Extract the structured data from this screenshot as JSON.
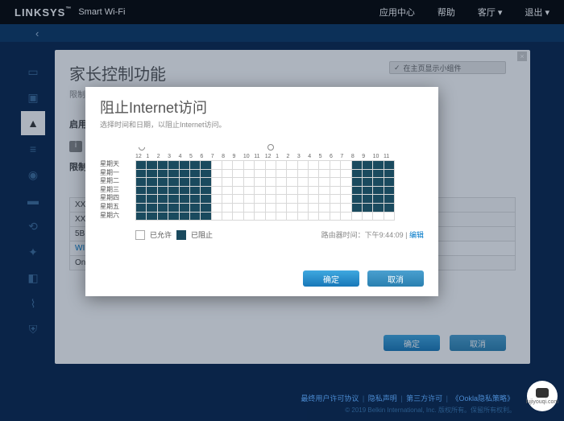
{
  "brand": {
    "name": "LINKSYS",
    "suite": "Smart Wi-Fi"
  },
  "topnav": {
    "appcenter": "应用中心",
    "help": "帮助",
    "account": "客厅",
    "logout": "退出"
  },
  "page": {
    "title": "家长控制功能",
    "subtitle": "限制",
    "enable_label": "启用",
    "restrict_label": "限制I"
  },
  "widget": {
    "label": "在主页显示小组件"
  },
  "devices": {
    "row1": "XX",
    "row2": "XX",
    "row3": "5B",
    "row4": "WI",
    "row5": "On"
  },
  "buttons": {
    "ok": "确定",
    "cancel": "取消"
  },
  "modal": {
    "title": "阻止Internet访问",
    "subtitle": "选择时间和日期，以阻止Internet访问。",
    "hours": [
      "12",
      "1",
      "2",
      "3",
      "4",
      "5",
      "6",
      "7",
      "8",
      "9",
      "10",
      "11",
      "12",
      "1",
      "2",
      "3",
      "4",
      "5",
      "6",
      "7",
      "8",
      "9",
      "10",
      "11"
    ],
    "days": [
      "星期天",
      "星期一",
      "星期二",
      "星期三",
      "星期四",
      "星期五",
      "星期六"
    ],
    "legend": {
      "allowed": "已允许",
      "blocked": "已阻止"
    },
    "router_time_label": "路由器时间：",
    "router_time": "下午9:44:09",
    "edit": "编辑",
    "ok": "确定",
    "cancel": "取消",
    "blocked_ranges": [
      [
        0,
        6
      ],
      [
        20,
        23
      ]
    ]
  },
  "footer": {
    "links": [
      "最终用户许可协议",
      "隐私声明",
      "第三方许可",
      "《Ookla隐私策略》"
    ],
    "copyright": "© 2019 Belkin International, Inc. 版权所有。保留所有权利。"
  },
  "help_badge": "lujiyouqi.com"
}
